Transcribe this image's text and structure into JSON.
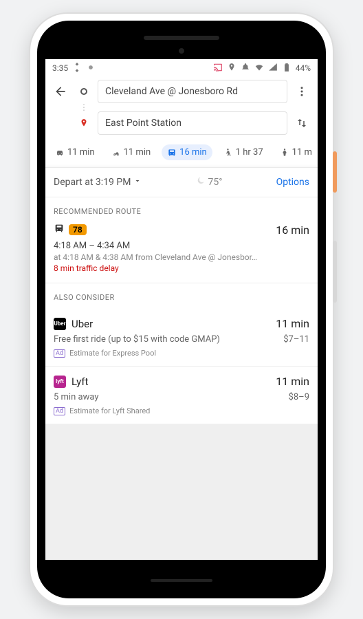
{
  "statusbar": {
    "time": "3:35",
    "battery": "44%"
  },
  "directions": {
    "from": "Cleveland Ave @ Jonesboro Rd",
    "to": "East Point Station"
  },
  "modes": {
    "car": "11 min",
    "moto": "11 min",
    "transit": "16 min",
    "walk": "1 hr 37",
    "rideshare": "11 m"
  },
  "controls": {
    "depart": "Depart at 3:19 PM",
    "temp": "75°",
    "options": "Options"
  },
  "sections": {
    "recommended": "RECOMMENDED ROUTE",
    "also": "ALSO CONSIDER"
  },
  "route": {
    "bus_number": "78",
    "eta": "16 min",
    "time_range": "4:18 AM – 4:34 AM",
    "detail": "at 4:18 AM & 4:38 AM from Cleveland Ave @ Jonesbor…",
    "warning": "8 min traffic delay"
  },
  "rides": [
    {
      "provider": "Uber",
      "logo_text": "Uber",
      "eta": "11 min",
      "sub": "Free first ride (up to $15 with code GMAP)",
      "price": "$7–11",
      "ad": "Estimate for Express Pool"
    },
    {
      "provider": "Lyft",
      "logo_text": "lyft",
      "eta": "11 min",
      "sub": "5 min away",
      "price": "$8–9",
      "ad": "Estimate for Lyft Shared"
    }
  ],
  "labels": {
    "ad": "Ad"
  }
}
